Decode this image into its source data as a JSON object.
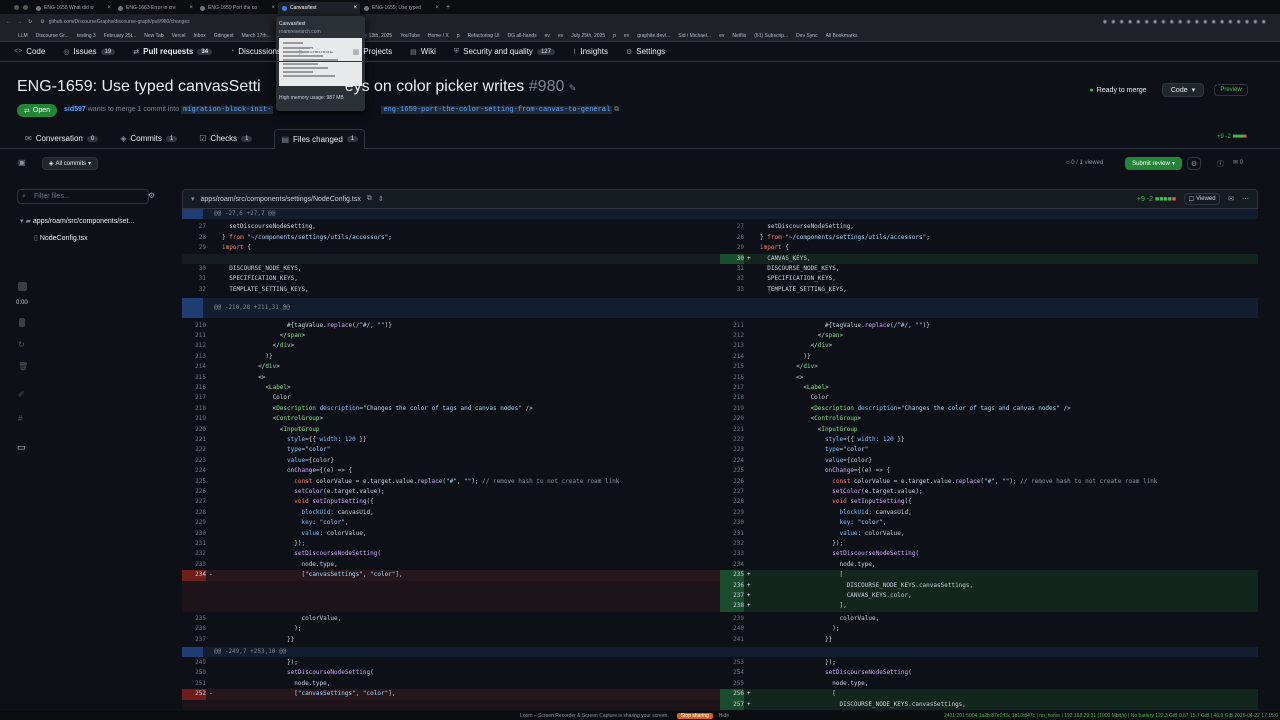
{
  "browser": {
    "tabs": [
      {
        "label": "ENG-1658 What did w"
      },
      {
        "label": "ENG-1663 Error in cre"
      },
      {
        "label": "ENG-1659 Port the co"
      },
      {
        "label": "Canvas/test",
        "active": true
      },
      {
        "label": "ENG-1659: Use typed"
      }
    ],
    "url": "github.com/DiscourseGraphs/discourse-graph/pull/980/changes",
    "bookmarks": [
      "LLM",
      "Discourse Gr...",
      "testing 3",
      "February 25t...",
      "New Tab",
      "Vercel",
      "Inbox",
      "Gitingest",
      "March 17th...",
      "roam/js/disc...",
      "Discourse-gr...",
      "May 13th, 2025",
      "YouTube",
      "Home / X",
      "p",
      "Refactoring UI",
      "DG all-hands",
      "ev",
      "ev",
      "July 25th, 2025",
      "p",
      "ev",
      "graphite.dev/...",
      "Sid / Michael...",
      "ev",
      "Netflix",
      "(61) Subscrip...",
      "Dev Sync",
      "All Bookmarks"
    ],
    "tooltip": {
      "title": "Canvas/test",
      "host": "roamresearch.com",
      "memory": "High memory usage: 987 MB"
    }
  },
  "repo_tabs": [
    {
      "label": "Code"
    },
    {
      "label": "Issues",
      "count": "19"
    },
    {
      "label": "Pull requests",
      "count": "34"
    },
    {
      "label": "Discussions"
    },
    {
      "label": "Actions"
    },
    {
      "label": "Projects"
    },
    {
      "label": "Wiki"
    },
    {
      "label": "Security and quality",
      "count": "127"
    },
    {
      "label": "Insights"
    },
    {
      "label": "Settings"
    }
  ],
  "pr": {
    "title_a": "ENG-1659: Use typed canvasSetti",
    "title_b": "eys on color picker writes",
    "number": "#980",
    "status": "Open",
    "author": "sid597",
    "merge_text": "wants to merge 1 commit into",
    "base_branch": "migration-block-init-",
    "head_branch": "eng-1659-port-the-color-setting-from-canvas-to-general",
    "ready": "Ready to merge",
    "code_btn": "Code",
    "preview": "Preview",
    "diffstat": "+9 -2"
  },
  "pr_tabs": [
    {
      "label": "Conversation",
      "count": "0"
    },
    {
      "label": "Commits",
      "count": "1"
    },
    {
      "label": "Checks",
      "count": "1"
    },
    {
      "label": "Files changed",
      "count": "1"
    }
  ],
  "toolbar": {
    "all_commits": "All commits",
    "viewed": "0 / 1 viewed",
    "submit": "Submit review",
    "comments": "0"
  },
  "filetree": {
    "filter_placeholder": "Filter files...",
    "folder": "apps/roam/src/components/set...",
    "file": "NodeConfig.tsx"
  },
  "dock": {
    "time": "0:00"
  },
  "file": {
    "path": "apps/roam/src/components/settings/NodeConfig.tsx",
    "stat": "+9 -2",
    "viewed": "Viewed"
  },
  "status": {
    "loom": "Loom – Screen Recorder & Screen Capture is sharing your screen.",
    "stop": "Stop sharing",
    "hide": "Hide",
    "sys": "2401:201:5004:1a2b:87e0:f3c:1b10:847c | no_home | 192.168.29.31 (1000 Mbit/s) | No battery 122.3 GiB 0.67 15.7 GiB | 46.9 GiB 2026-04-22 17:15:0"
  }
}
